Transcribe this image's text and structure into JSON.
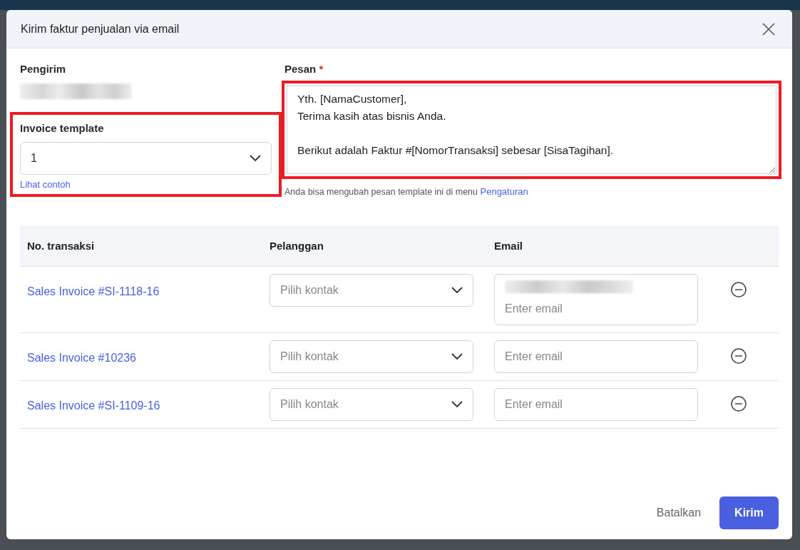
{
  "dialog": {
    "title": "Kirim faktur penjualan via email"
  },
  "sender": {
    "label": "Pengirim",
    "redacted": true
  },
  "template": {
    "label": "Invoice template",
    "value": "1",
    "highlighted": true,
    "link": "Lihat contoh"
  },
  "message": {
    "label": "Pesan",
    "required_mark": "*",
    "highlighted": true,
    "value": "Yth. [NamaCustomer],\nTerima kasih atas bisnis Anda.\n\nBerikut adalah Faktur #[NomorTransaksi] sebesar [SisaTagihan].",
    "hint": "Anda bisa mengubah pesan template ini di menu",
    "hint_link": "Pengaturan"
  },
  "table": {
    "columns": [
      "No. transaksi",
      "Pelanggan",
      "Email"
    ],
    "rows": [
      {
        "transaction": "Sales Invoice #SI-1118-16",
        "customer_placeholder": "Pilih kontak",
        "email_redacted": true,
        "email_placeholder": "Enter email"
      },
      {
        "transaction": "Sales Invoice #10236",
        "customer_placeholder": "Pilih kontak",
        "email_redacted": false,
        "email_placeholder": "Enter email"
      },
      {
        "transaction": "Sales Invoice #SI-1109-16",
        "customer_placeholder": "Pilih kontak",
        "email_redacted": false,
        "email_placeholder": "Enter email"
      }
    ]
  },
  "buttons": {
    "cancel": "Batalkan",
    "submit": "Kirim"
  }
}
